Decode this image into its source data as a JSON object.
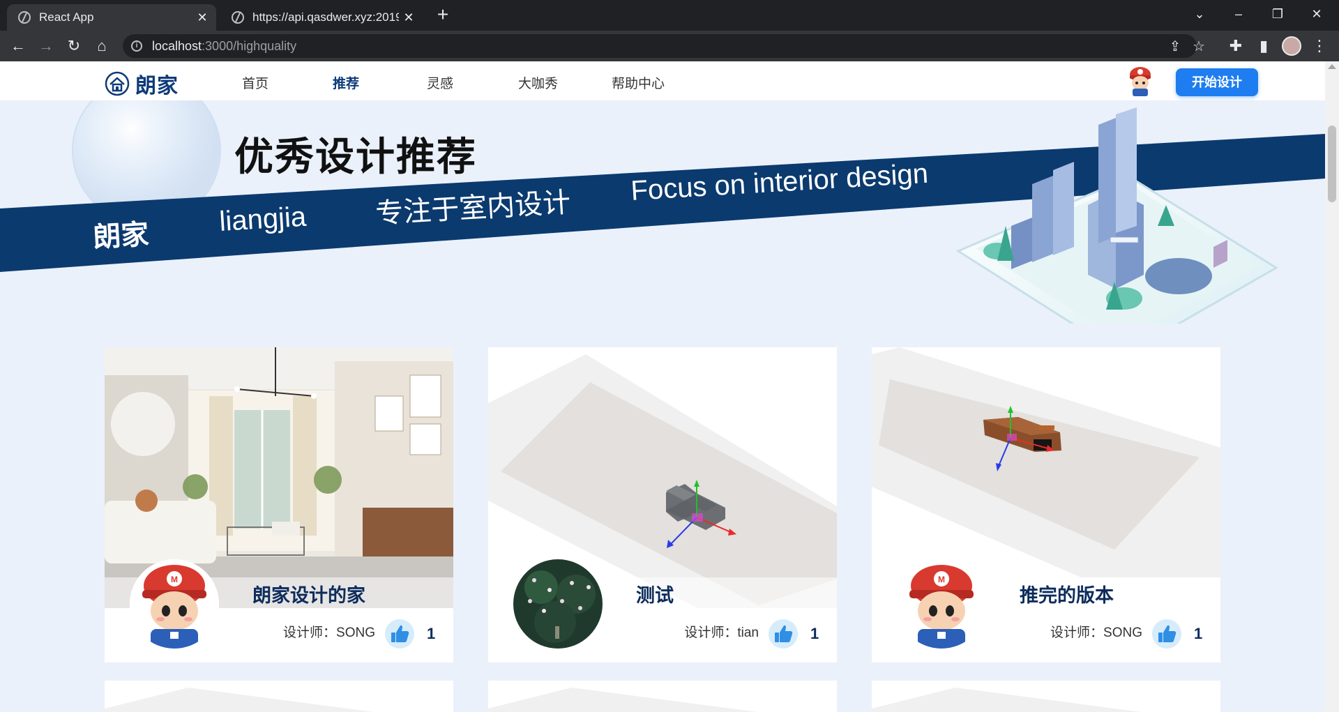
{
  "browser": {
    "tabs": [
      {
        "title": "React App",
        "active": true
      },
      {
        "title": "https://api.qasdwer.xyz:2019/g",
        "active": false
      }
    ],
    "new_tab_label": "+",
    "url": {
      "host": "localhost",
      "rest": ":3000/highquality"
    },
    "window_controls": {
      "dropdown": "⌄",
      "minimize": "–",
      "restore": "❐",
      "close": "✕"
    }
  },
  "site": {
    "logo_text": "朗家",
    "nav": [
      {
        "label": "首页",
        "active": false
      },
      {
        "label": "推荐",
        "active": true
      },
      {
        "label": "灵感",
        "active": false
      },
      {
        "label": "大咖秀",
        "active": false
      },
      {
        "label": "帮助中心",
        "active": false
      }
    ],
    "start_button": "开始设计",
    "brand_color": "#0d3a78",
    "accent_color": "#1e7df0"
  },
  "banner": {
    "title": "优秀设计推荐",
    "stripe": [
      "朗家",
      "liangjia",
      "专注于室内设计",
      "Focus on interior design"
    ],
    "stripe_color": "#0b3a6e"
  },
  "cards": [
    {
      "title": "朗家设计的家",
      "designer": "设计师：SONG",
      "likes": "1",
      "image": "living-room-photo",
      "avatar": "mario-avatar"
    },
    {
      "title": "测试",
      "designer": "设计师：tian",
      "likes": "1",
      "image": "3d-sofa-render",
      "avatar": "flower-avatar"
    },
    {
      "title": "推完的版本",
      "designer": "设计师：SONG",
      "likes": "1",
      "image": "3d-cabinet-render",
      "avatar": "mario-avatar"
    }
  ]
}
